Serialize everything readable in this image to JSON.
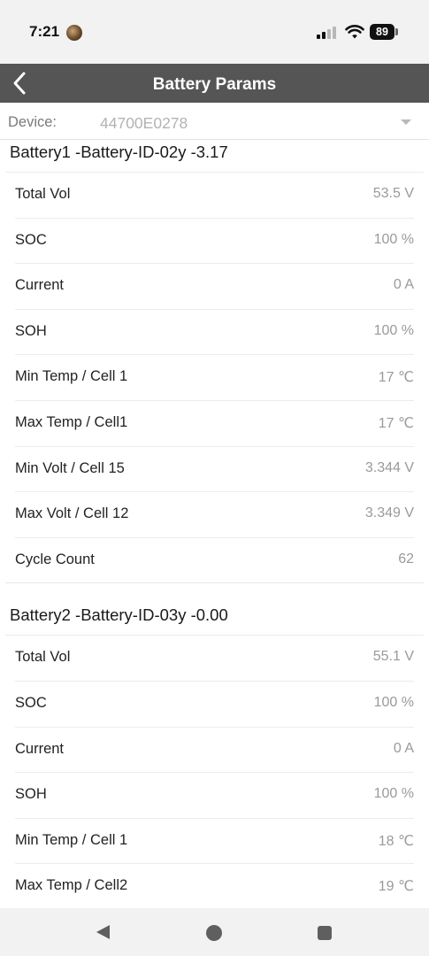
{
  "status_bar": {
    "time": "7:21",
    "battery_level": "89"
  },
  "header": {
    "title": "Battery Params"
  },
  "device": {
    "label": "Device:",
    "value": "44700E0278"
  },
  "batteries": [
    {
      "title": "Battery1 -Battery-ID-02y -3.17",
      "params": [
        {
          "label": "Total Vol",
          "value": "53.5 V"
        },
        {
          "label": "SOC",
          "value": "100 %"
        },
        {
          "label": "Current",
          "value": "0 A"
        },
        {
          "label": "SOH",
          "value": "100 %"
        },
        {
          "label": "Min Temp / Cell 1",
          "value": "17 ℃"
        },
        {
          "label": "Max Temp / Cell1",
          "value": "17 ℃"
        },
        {
          "label": "Min Volt / Cell 15",
          "value": "3.344 V"
        },
        {
          "label": "Max Volt / Cell 12",
          "value": "3.349 V"
        },
        {
          "label": "Cycle Count",
          "value": "62"
        }
      ]
    },
    {
      "title": "Battery2 -Battery-ID-03y -0.00",
      "params": [
        {
          "label": "Total Vol",
          "value": "55.1 V"
        },
        {
          "label": "SOC",
          "value": "100 %"
        },
        {
          "label": "Current",
          "value": "0 A"
        },
        {
          "label": "SOH",
          "value": "100 %"
        },
        {
          "label": "Min Temp / Cell 1",
          "value": "18 ℃"
        },
        {
          "label": "Max Temp / Cell2",
          "value": "19 ℃"
        }
      ]
    }
  ],
  "icons": {
    "back": "chevron-left-icon",
    "signal": "cellular-signal-icon",
    "wifi": "wifi-icon",
    "dropdown": "caret-down-icon",
    "nav_back": "triangle-back-icon",
    "nav_home": "circle-home-icon",
    "nav_recent": "square-recent-icon"
  },
  "colors": {
    "header_bg": "#555555",
    "header_text": "#ffffff",
    "value_text": "#9a9a9a",
    "system_bar_bg": "#f2f2f2"
  }
}
